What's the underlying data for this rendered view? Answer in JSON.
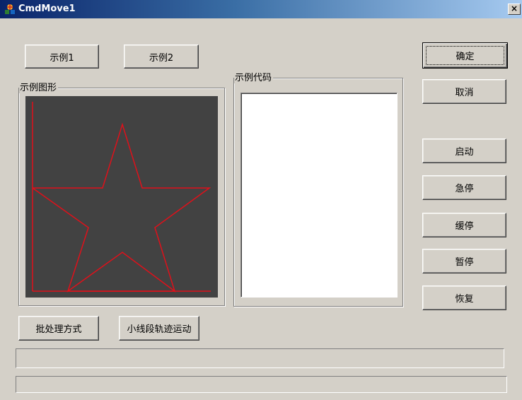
{
  "window": {
    "title": "CmdMove1",
    "close_glyph": "×"
  },
  "buttons": {
    "example1": "示例1",
    "example2": "示例2",
    "ok": "确定",
    "cancel": "取消",
    "start": "启动",
    "emergency_stop": "急停",
    "slow_stop": "缓停",
    "pause": "暂停",
    "resume": "恢复",
    "batch_mode": "批处理方式",
    "small_segment": "小线段轨迹运动"
  },
  "groups": {
    "example_graphic": "示例图形",
    "example_code": "示例代码"
  },
  "code_box": {
    "value": ""
  },
  "status": {
    "line1": "",
    "line2": ""
  },
  "colors": {
    "canvas_bg": "#424242",
    "path_color": "#e0101a",
    "window_bg": "#d4d0c8"
  },
  "icons": {
    "app_icon": "app-icon",
    "close": "close-icon"
  }
}
